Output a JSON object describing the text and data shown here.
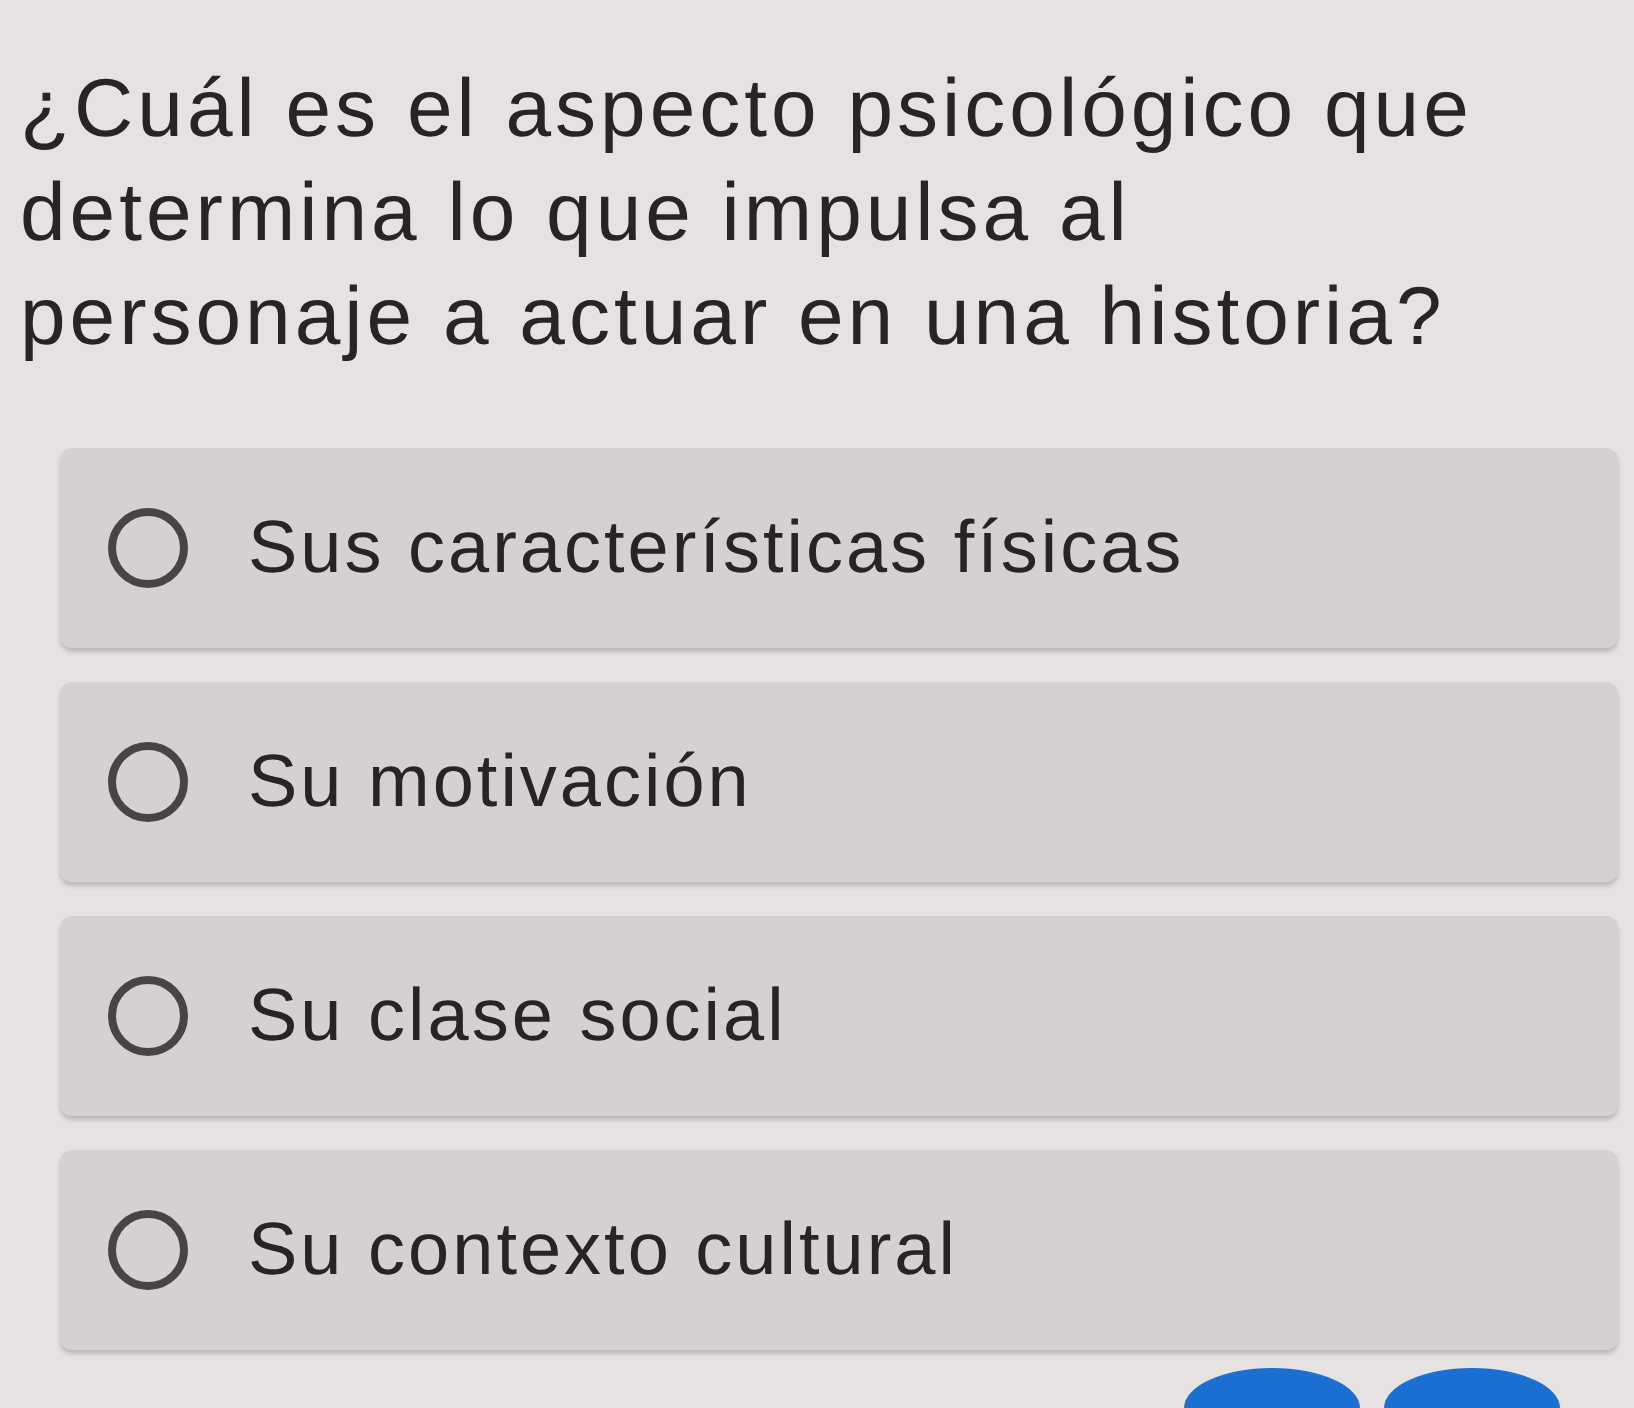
{
  "question": "¿Cuál es el aspecto psicológico que determina lo que impulsa al personaje a actuar en una historia?",
  "options": [
    {
      "label": "Sus características físicas",
      "selected": false
    },
    {
      "label": "Su motivación",
      "selected": false
    },
    {
      "label": "Su clase social",
      "selected": false
    },
    {
      "label": "Su contexto cultural",
      "selected": false
    }
  ]
}
